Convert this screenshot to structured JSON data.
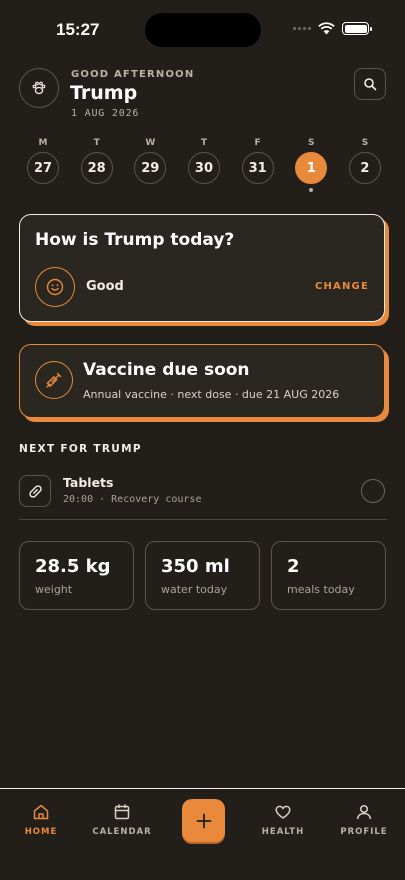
{
  "status": {
    "time": "15:27"
  },
  "header": {
    "greeting": "GOOD AFTERNOON",
    "pet_name": "Trump",
    "date": "1 AUG 2026",
    "avatar_icon": "paw-icon",
    "search_icon": "search-icon"
  },
  "week": {
    "days": [
      {
        "letter": "M",
        "num": "27"
      },
      {
        "letter": "T",
        "num": "28"
      },
      {
        "letter": "W",
        "num": "29"
      },
      {
        "letter": "T",
        "num": "30"
      },
      {
        "letter": "F",
        "num": "31"
      },
      {
        "letter": "S",
        "num": "1"
      },
      {
        "letter": "S",
        "num": "2"
      }
    ],
    "selected_index": 5
  },
  "mood_card": {
    "title": "How is Trump today?",
    "value": "Good",
    "action": "CHANGE",
    "icon": "smiley-icon"
  },
  "vaccine_card": {
    "title": "Vaccine due soon",
    "subtitle": "Annual vaccine · next dose · due 21 AUG 2026",
    "icon": "syringe-icon"
  },
  "next": {
    "heading": "NEXT FOR TRUMP",
    "items": [
      {
        "title": "Tablets",
        "subtitle": "20:00 · Recovery course",
        "icon": "pill-icon"
      }
    ]
  },
  "stats": [
    {
      "value": "28.5 kg",
      "label": "weight"
    },
    {
      "value": "350 ml",
      "label": "water today"
    },
    {
      "value": "2",
      "label": "meals today"
    }
  ],
  "tabbar": {
    "home": "HOME",
    "calendar": "CALENDAR",
    "add": "+",
    "health": "HEALTH",
    "profile": "PROFILE"
  },
  "colors": {
    "background": "#221f1a",
    "accent": "#e8893b",
    "card": "#2a2620",
    "border": "#5a554c"
  }
}
